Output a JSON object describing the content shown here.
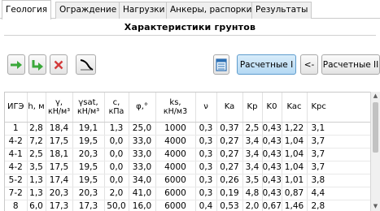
{
  "tabs": [
    "Геология",
    "Ограждение",
    "Нагрузки",
    "Анкеры, распорки",
    "Результаты"
  ],
  "active_tab": "Геология",
  "section_title": "Характеристики грунтов",
  "toolbar": {
    "add_icon": "arrow-right-icon",
    "insert_icon": "arrow-down-right-icon",
    "delete_icon": "delete-x-icon",
    "curve_icon": "diagram-curve-icon",
    "table_icon": "table-icon",
    "calc1_label": "Расчетные I",
    "prev_label": "<-",
    "calc2_label": "Расчетные II"
  },
  "table": {
    "columns": [
      {
        "name": "ИГЭ",
        "unit": ""
      },
      {
        "name": "h, м",
        "unit": ""
      },
      {
        "name": "γ,",
        "unit": "кН/м³"
      },
      {
        "name": "γsat,",
        "unit": "кН/м³"
      },
      {
        "name": "c,",
        "unit": "кПа"
      },
      {
        "name": "φ,°",
        "unit": ""
      },
      {
        "name": "ks,",
        "unit": "кН/м3"
      },
      {
        "name": "ν",
        "unit": ""
      },
      {
        "name": "Ka",
        "unit": ""
      },
      {
        "name": "Kp",
        "unit": ""
      },
      {
        "name": "K0",
        "unit": ""
      },
      {
        "name": "Kac",
        "unit": ""
      },
      {
        "name": "Kpc",
        "unit": ""
      }
    ],
    "rows": [
      [
        "1",
        "2,8",
        "18,4",
        "19,1",
        "1,3",
        "25,0",
        "1000",
        "0,3",
        "0,37",
        "2,5",
        "0,43",
        "1,22",
        "3,1"
      ],
      [
        "4-2",
        "7,2",
        "17,5",
        "19,5",
        "0,0",
        "33,0",
        "4000",
        "0,3",
        "0,27",
        "3,4",
        "0,43",
        "1,04",
        "3,7"
      ],
      [
        "4-1",
        "2,5",
        "18,1",
        "20,3",
        "0,0",
        "33,0",
        "4000",
        "0,3",
        "0,27",
        "3,4",
        "0,43",
        "1,04",
        "3,7"
      ],
      [
        "4-2",
        "3,5",
        "17,5",
        "19,5",
        "0,0",
        "33,0",
        "4000",
        "0,3",
        "0,27",
        "3,4",
        "0,43",
        "1,04",
        "3,7"
      ],
      [
        "5-2",
        "1,3",
        "17,4",
        "19,5",
        "0,0",
        "34,0",
        "6000",
        "0,3",
        "0,26",
        "3,5",
        "0,43",
        "1,01",
        "3,8"
      ],
      [
        "7-2",
        "1,3",
        "20,3",
        "20,3",
        "2,0",
        "41,0",
        "6000",
        "0,3",
        "0,19",
        "4,8",
        "0,43",
        "0,87",
        "4,4"
      ],
      [
        "8",
        "6,0",
        "17,3",
        "17,3",
        "50,0",
        "16,0",
        "6000",
        "0,4",
        "0,53",
        "2,0",
        "0,67",
        "1,46",
        "2,8"
      ]
    ]
  }
}
